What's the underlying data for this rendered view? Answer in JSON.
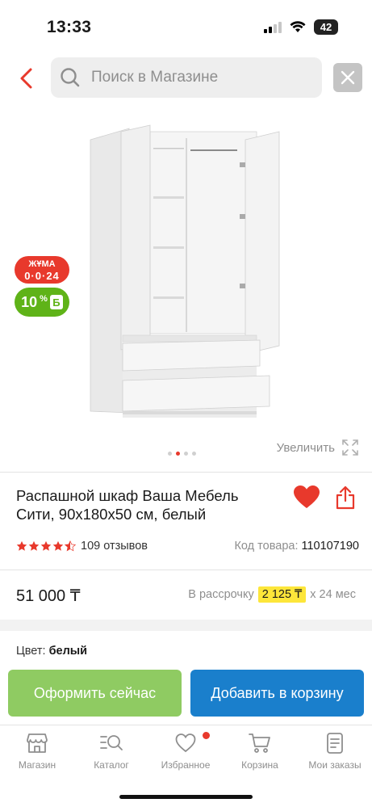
{
  "status_bar": {
    "time": "13:33",
    "battery": "42"
  },
  "search": {
    "placeholder": "Поиск в Магазине"
  },
  "gallery": {
    "badge_friday_line1": "ЖҰМА",
    "badge_friday_line2": "0·0·24",
    "badge_bonus_value": "10",
    "badge_bonus_percent": "%",
    "badge_bonus_symbol": "Б",
    "zoom_label": "Увеличить",
    "image_count": 4,
    "active_image_index": 2
  },
  "product": {
    "title": "Распашной шкаф Ваша Мебель Сити, 90х180х50 см, белый",
    "rating": 4.5,
    "reviews": "109 отзывов",
    "sku_label": "Код товара:",
    "sku_value": "110107190",
    "price": "51 000 ₸",
    "installment_prefix": "В рассрочку",
    "installment_amount": "2 125 ₸",
    "installment_suffix": "х 24 мес",
    "color_label": "Цвет:",
    "color_value": "белый"
  },
  "actions": {
    "buy_now": "Оформить сейчас",
    "add_to_cart": "Добавить в корзину"
  },
  "bottom_nav": {
    "items": [
      {
        "label": "Магазин",
        "icon": "store-icon"
      },
      {
        "label": "Каталог",
        "icon": "catalog-search-icon"
      },
      {
        "label": "Избранное",
        "icon": "heart-icon"
      },
      {
        "label": "Корзина",
        "icon": "cart-icon"
      },
      {
        "label": "Мои заказы",
        "icon": "orders-icon"
      }
    ]
  },
  "colors": {
    "accent_red": "#e8392c",
    "buy_green": "#8fcb62",
    "cart_blue": "#1a7fcc",
    "bonus_green": "#5fb318",
    "installment_yellow": "#fde63a"
  }
}
